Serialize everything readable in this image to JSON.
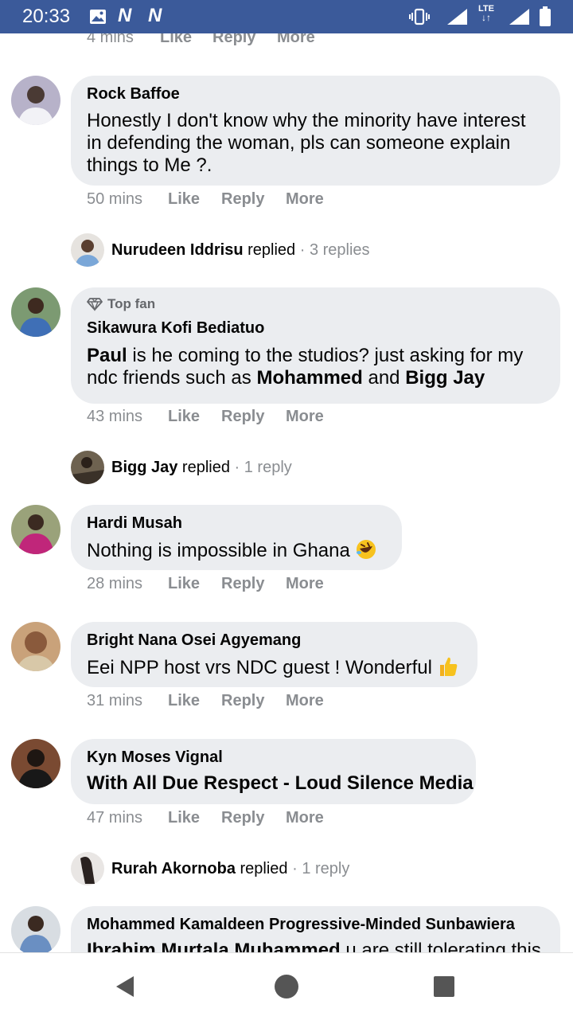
{
  "status_bar": {
    "time": "20:33",
    "icons": [
      "image-icon",
      "notification-n-icon",
      "notification-n-icon",
      "vibrate-icon",
      "signal-icon",
      "lte-icon",
      "signal-icon",
      "battery-icon"
    ],
    "lte_label": "LTE"
  },
  "actions_labels": {
    "like": "Like",
    "reply": "Reply",
    "more": "More"
  },
  "partial_top": {
    "time": "4 mins"
  },
  "comments": [
    {
      "author": "Rock Baffoe",
      "text": "Honestly I don't know why the minority have interest in defending the woman, pls can someone explain things to Me ?.",
      "time": "50 mins"
    },
    {
      "author": "Sikawura Kofi Bediatuo",
      "badge": "Top fan",
      "text_parts": [
        "Paul",
        " is he coming to the studios? just asking for my ndc friends such as ",
        "Mohammed",
        " and ",
        "Bigg Jay"
      ],
      "time": "43 mins"
    },
    {
      "author": "Hardi Musah",
      "text": "Nothing is impossible in Ghana",
      "emoji": "rolling-on-floor-laughing-emoji",
      "time": "28 mins"
    },
    {
      "author": "Bright Nana Osei Agyemang",
      "text": "Eei NPP host vrs NDC guest ! Wonderful",
      "emoji": "thumbs-up-emoji",
      "time": "31 mins"
    },
    {
      "author": "Kyn Moses Vignal",
      "text": "With All Due Respect - Loud Silence Media",
      "time": "47 mins"
    },
    {
      "author": "Mohammed Kamaldeen Progressive-Minded Sunbawiera",
      "text_parts": [
        "Ibrahim Murtala Muhammed",
        " u are still tolerating this"
      ]
    }
  ],
  "replies": [
    {
      "name": "Nurudeen Iddrisu",
      "verb": " replied",
      "count": " · 3 replies"
    },
    {
      "name": "Bigg Jay",
      "verb": " replied",
      "count": " · 1 reply"
    },
    {
      "name": "Rurah Akornoba",
      "verb": " replied",
      "count": " · 1 reply"
    }
  ],
  "nav_bar": {
    "buttons": [
      "back-icon",
      "home-icon",
      "recents-icon"
    ]
  },
  "colors": {
    "status_bar": "#3b5a9a",
    "bubble": "#ebedf0",
    "meta_text": "#8a8d91"
  }
}
